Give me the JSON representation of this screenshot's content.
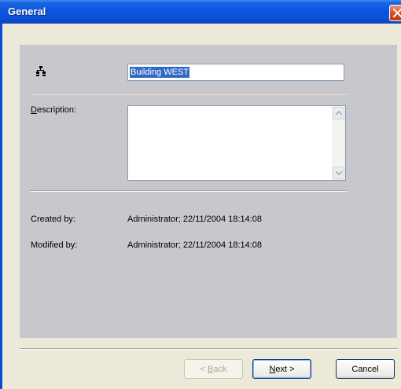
{
  "window": {
    "title": "General"
  },
  "form": {
    "name_value": "Building WEST",
    "description_label_prefix": "",
    "description_label_accel": "D",
    "description_label_rest": "escription:",
    "description_value": "",
    "created_by_label": "Created by:",
    "created_by_value": "Administrator; 22/11/2004 18:14:08",
    "modified_by_label": "Modified by:",
    "modified_by_value": "Administrator; 22/11/2004 18:14:08"
  },
  "buttons": {
    "back_prefix": "< ",
    "back_accel": "B",
    "back_rest": "ack",
    "next_accel": "N",
    "next_rest": "ext >",
    "cancel": "Cancel"
  },
  "icons": {
    "close": "close-icon",
    "network": "network-tree-icon",
    "scroll_up": "scroll-up-arrow-icon",
    "scroll_down": "scroll-down-arrow-icon"
  },
  "colors": {
    "titlebar": "#0a55e0",
    "panel": "#c8c7cb",
    "window_bg": "#ece9d8",
    "selection": "#316ac5",
    "close_button": "#d6532c"
  }
}
